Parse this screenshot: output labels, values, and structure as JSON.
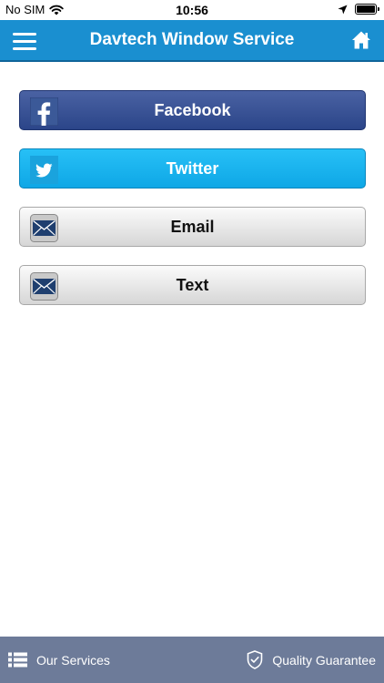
{
  "status_bar": {
    "carrier": "No SIM",
    "time": "10:56"
  },
  "nav": {
    "title": "Davtech Window Service",
    "menu_icon": "hamburger-menu-icon",
    "home_icon": "home-icon"
  },
  "share": {
    "items": [
      {
        "label": "Facebook",
        "icon": "facebook-icon",
        "color": "#3b5998"
      },
      {
        "label": "Twitter",
        "icon": "twitter-icon",
        "color": "#1eb4f0"
      },
      {
        "label": "Email",
        "icon": "envelope-icon",
        "color": "#e6e6e6"
      },
      {
        "label": "Text",
        "icon": "envelope-icon",
        "color": "#e6e6e6"
      }
    ]
  },
  "tabbar": {
    "services_label": "Our Services",
    "quality_label": "Quality Guarantee",
    "color": "#6d7b99"
  },
  "colors": {
    "accent": "#1a8fd0"
  }
}
